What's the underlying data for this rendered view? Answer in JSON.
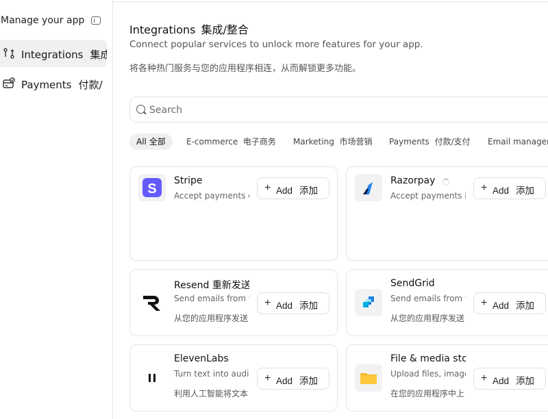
{
  "sidebar": {
    "title": "Manage your app",
    "items": [
      {
        "label": "Integrations",
        "label_cn": "集成",
        "active": true
      },
      {
        "label": "Payments",
        "label_cn": "付款/"
      }
    ]
  },
  "header": {
    "title": "Integrations",
    "title_cn": "集成/整合",
    "subtitle": "Connect popular services to unlock more features for your app.",
    "subtitle_cn": "将各种热门服务与您的应用程序相连，从而解锁更多功能。"
  },
  "search": {
    "placeholder": "Search"
  },
  "filters": [
    {
      "label": "All",
      "label_cn": "全部",
      "active": true
    },
    {
      "label": "E-commerce",
      "label_cn": "电子商务"
    },
    {
      "label": "Marketing",
      "label_cn": "市场营销"
    },
    {
      "label": "Payments",
      "label_cn": "付款/支付"
    },
    {
      "label": "Email managem",
      "label_cn": ""
    }
  ],
  "add_label": "Add",
  "add_label_cn": "添加",
  "cards": [
    {
      "name": "Stripe",
      "desc": "Accept payments o",
      "desc_cn": ""
    },
    {
      "name": "Razorpay",
      "desc": "Accept payments in",
      "desc_cn": ""
    },
    {
      "name": "Resend  重新发送",
      "desc": "Send emails from y",
      "desc_cn": "从您的应用程序发送"
    },
    {
      "name": "SendGrid",
      "desc": "Send emails from y",
      "desc_cn": "从您的应用程序发送"
    },
    {
      "name": "ElevenLabs",
      "desc": "Turn text into audio",
      "desc_cn": "利用人工智能将文本"
    },
    {
      "name": "File & media stor",
      "desc": "Upload files, image",
      "desc_cn": "在您的应用程序中上"
    }
  ],
  "colors": {
    "stripe": "#635BFF",
    "razorpay": "#2B84EA",
    "sendgrid": "#1A82E2",
    "folder": "#F5B82E"
  }
}
